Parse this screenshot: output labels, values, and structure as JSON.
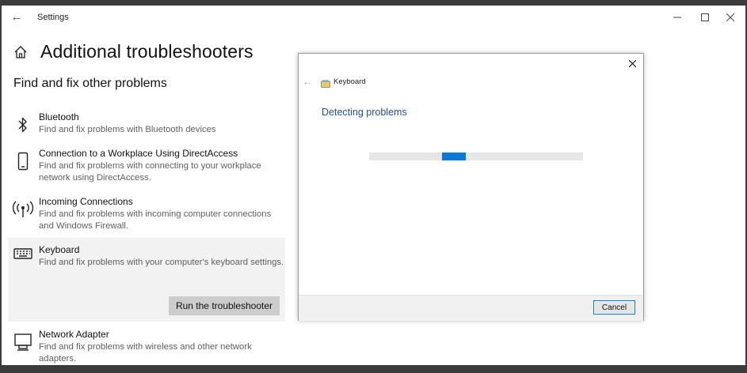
{
  "window": {
    "title": "Settings",
    "controls": {
      "minimize": "minimize",
      "maximize": "maximize",
      "close": "close"
    }
  },
  "page": {
    "title": "Additional troubleshooters",
    "section_title": "Find and fix other problems"
  },
  "troubleshooters": [
    {
      "icon": "bluetooth-icon",
      "name": "Bluetooth",
      "description": "Find and fix problems with Bluetooth devices"
    },
    {
      "icon": "phone-icon",
      "name": "Connection to a Workplace Using DirectAccess",
      "description": "Find and fix problems with connecting to your workplace network using DirectAccess."
    },
    {
      "icon": "antenna-icon",
      "name": "Incoming Connections",
      "description": "Find and fix problems with incoming computer connections and Windows Firewall."
    },
    {
      "icon": "keyboard-icon",
      "name": "Keyboard",
      "description": "Find and fix problems with your computer's keyboard settings.",
      "selected": true,
      "action_label": "Run the troubleshooter"
    },
    {
      "icon": "network-adapter-icon",
      "name": "Network Adapter",
      "description": "Find and fix problems with wireless and other network adapters."
    }
  ],
  "dialog": {
    "title": "Keyboard",
    "heading": "Detecting problems",
    "progress": "indeterminate",
    "cancel_label": "Cancel"
  },
  "colors": {
    "accent": "#0078d7",
    "dialog_heading": "#1f4e99",
    "selected_bg": "#f2f2f2",
    "button_bg": "#cccccc"
  }
}
